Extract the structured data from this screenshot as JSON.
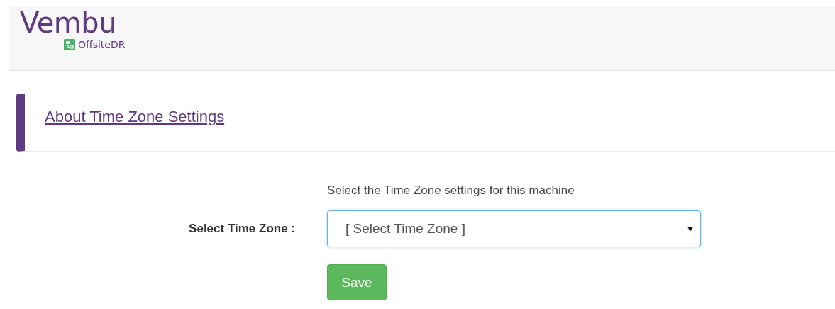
{
  "header": {
    "logo": "Vembu",
    "product": "OffsiteDR"
  },
  "info_panel": {
    "link": "About Time Zone Settings"
  },
  "form": {
    "instruction": "Select the Time Zone settings for this machine",
    "label": "Select Time Zone :",
    "time_zone": {
      "value": "[ Select Time Zone ]",
      "focused": true
    },
    "save_button": "Save"
  }
}
